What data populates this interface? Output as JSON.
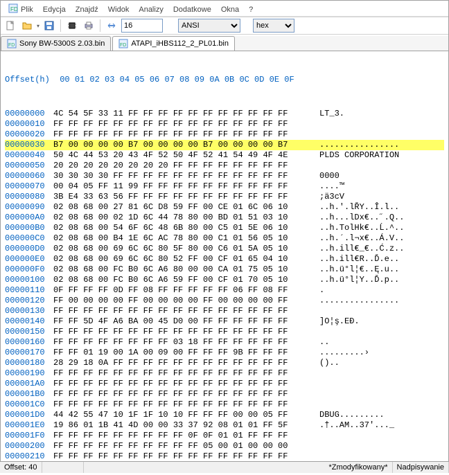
{
  "menu": {
    "items": [
      "Plik",
      "Edycja",
      "Znajdź",
      "Widok",
      "Analizy",
      "Dodatkowe",
      "Okna",
      "?"
    ]
  },
  "toolbar": {
    "bytesPerLine": "16",
    "charset": "ANSI",
    "base": "hex"
  },
  "tabs": [
    {
      "label": "Sony BW-5300S 2.03.bin",
      "active": false
    },
    {
      "label": "ATAPI_iHBS112_2_PL01.bin",
      "active": true
    }
  ],
  "hex": {
    "header": "Offset(h)  00 01 02 03 04 05 06 07 08 09 0A 0B 0C 0D 0E 0F",
    "rows": [
      {
        "off": "00000000",
        "h": "4C 54 5F 33 11 FF FF FF FF FF FF FF FF FF FF FF",
        "a": "LT_3.",
        "hl": false
      },
      {
        "off": "00000010",
        "h": "FF FF FF FF FF FF FF FF FF FF FF FF FF FF FF FF",
        "a": "",
        "hl": false
      },
      {
        "off": "00000020",
        "h": "FF FF FF FF FF FF FF FF FF FF FF FF FF FF FF FF",
        "a": "",
        "hl": false
      },
      {
        "off": "00000030",
        "h": "B7 00 00 00 00 B7 00 00 00 00 B7 00 00 00 00 B7",
        "a": "................",
        "hl": true
      },
      {
        "off": "00000040",
        "h": "50 4C 44 53 20 43 4F 52 50 4F 52 41 54 49 4F 4E",
        "a": "PLDS CORPORATION",
        "hl": false
      },
      {
        "off": "00000050",
        "h": "20 20 20 20 20 20 20 20 FF FF FF FF FF FF FF FF",
        "a": "",
        "hl": false
      },
      {
        "off": "00000060",
        "h": "30 30 30 30 FF FF FF FF FF FF FF FF FF FF FF FF",
        "a": "0000",
        "hl": false
      },
      {
        "off": "00000070",
        "h": "00 04 05 FF 11 99 FF FF FF FF FF FF FF FF FF FF",
        "a": "....™",
        "hl": false
      },
      {
        "off": "00000080",
        "h": "3B E4 33 63 56 FF FF FF FF FF FF FF FF FF FF FF",
        "a": ";ä3cV",
        "hl": false
      },
      {
        "off": "00000090",
        "h": "02 08 68 00 27 81 6C D8 59 FF 00 CE 01 6C 06 10",
        "a": "..h.'.lŘY..Î.l..",
        "hl": false
      },
      {
        "off": "000000A0",
        "h": "02 08 68 00 02 1D 6C 44 78 80 00 BD 01 51 03 10",
        "a": "..h...lDx€..˝.Q..",
        "hl": false
      },
      {
        "off": "000000B0",
        "h": "02 08 68 00 54 6F 6C 48 6B 80 00 C5 01 5E 06 10",
        "a": "..h.TolHk€..Ĺ.^..",
        "hl": false
      },
      {
        "off": "000000C0",
        "h": "02 08 68 00 B4 1E 6C AC 78 80 00 C1 01 56 05 10",
        "a": "..h.´.l¬x€..Á.V..",
        "hl": false
      },
      {
        "off": "000000D0",
        "h": "02 08 68 00 69 6C 6C 80 5F 80 00 C6 01 5A 05 10",
        "a": "..h.ill€_€..Ć.z..",
        "hl": false
      },
      {
        "off": "000000E0",
        "h": "02 08 68 00 69 6C 6C 80 52 FF 00 CF 01 65 04 10",
        "a": "..h.ill€R..Ď.e..",
        "hl": false
      },
      {
        "off": "000000F0",
        "h": "02 08 68 00 FC B0 6C A6 80 00 00 CA 01 75 05 10",
        "a": "..h.ü°l¦€..Ę.u..",
        "hl": false
      },
      {
        "off": "00000100",
        "h": "02 08 68 00 FC B0 6C A6 59 FF 00 CF 01 70 05 10",
        "a": "..h.ü°l¦Y..Ď.p..",
        "hl": false
      },
      {
        "off": "00000110",
        "h": "0F FF FF FF 0D FF 08 FF FF FF FF FF 06 FF 08 FF",
        "a": ".",
        "hl": false
      },
      {
        "off": "00000120",
        "h": "FF 00 00 00 00 FF 00 00 00 00 FF 00 00 00 00 FF",
        "a": "................",
        "hl": false
      },
      {
        "off": "00000130",
        "h": "FF FF FF FF FF FF FF FF FF FF FF FF FF FF FF FF",
        "a": "",
        "hl": false
      },
      {
        "off": "00000140",
        "h": "FF FF 5D 4F A6 BA 00 45 D0 00 FF FF FF FF FF FF",
        "a": "]O¦ş.EĐ.",
        "hl": false
      },
      {
        "off": "00000150",
        "h": "FF FF FF FF FF FF FF FF FF FF FF FF FF FF FF FF",
        "a": "",
        "hl": false
      },
      {
        "off": "00000160",
        "h": "FF FF FF FF FF FF FF FF 03 18 FF FF FF FF FF FF",
        "a": "..",
        "hl": false
      },
      {
        "off": "00000170",
        "h": "FF FF 01 19 00 1A 00 09 00 FF FF FF 9B FF FF FF",
        "a": ".........›",
        "hl": false
      },
      {
        "off": "00000180",
        "h": "28 29 18 0A FF FF FF FF FF FF FF FF FF FF FF FF",
        "a": "()..",
        "hl": false
      },
      {
        "off": "00000190",
        "h": "FF FF FF FF FF FF FF FF FF FF FF FF FF FF FF FF",
        "a": "",
        "hl": false
      },
      {
        "off": "000001A0",
        "h": "FF FF FF FF FF FF FF FF FF FF FF FF FF FF FF FF",
        "a": "",
        "hl": false
      },
      {
        "off": "000001B0",
        "h": "FF FF FF FF FF FF FF FF FF FF FF FF FF FF FF FF",
        "a": "",
        "hl": false
      },
      {
        "off": "000001C0",
        "h": "FF FF FF FF FF FF FF FF FF FF FF FF FF FF FF FF",
        "a": "",
        "hl": false
      },
      {
        "off": "000001D0",
        "h": "44 42 55 47 10 1F 1F 10 10 FF FF FF 00 00 05 FF",
        "a": "DBUG.........",
        "hl": false
      },
      {
        "off": "000001E0",
        "h": "19 86 01 1B 41 4D 00 00 33 37 92 08 01 01 FF 5F",
        "a": ".†..AM..37'..._",
        "hl": false
      },
      {
        "off": "000001F0",
        "h": "FF FF FF FF FF FF FF FF FF 0F 0F 01 01 FF FF FF",
        "a": "",
        "hl": false
      },
      {
        "off": "00000200",
        "h": "FF FF FF FF FF FF FF FF FF FF 05 00 01 00 00 00",
        "a": "",
        "hl": false
      },
      {
        "off": "00000210",
        "h": "FF FF FF FF FF FF FF FF FF FF FF FF FF FF FF FF",
        "a": "",
        "hl": false
      }
    ]
  },
  "status": {
    "offset_label": "Offset:",
    "offset_value": "40",
    "modified": "*Zmodyfikowany*",
    "mode": "Nadpisywanie"
  }
}
